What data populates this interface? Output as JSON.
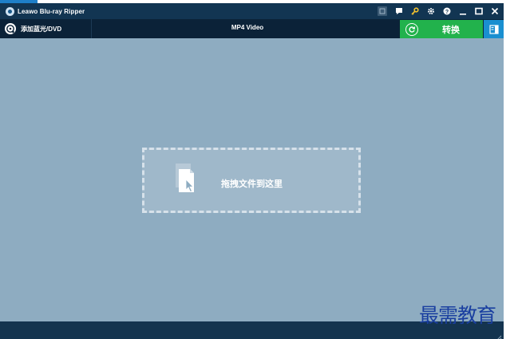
{
  "window": {
    "title": "Leawo Blu-ray Ripper"
  },
  "titlebar_icons": [
    "menu-box-icon",
    "chat-icon",
    "key-icon",
    "gear-icon",
    "help-icon",
    "minimize-icon",
    "maximize-icon",
    "close-icon"
  ],
  "toolbar": {
    "add_label": "添加蓝光/DVD",
    "format_label": "MP4 Video",
    "convert_label": "转换"
  },
  "dropzone": {
    "label": "拖拽文件到这里"
  },
  "watermark": "最需教育",
  "colors": {
    "titlebar": "#123552",
    "toolbar": "#0b2238",
    "content": "#8eacc1",
    "convert": "#22b24c",
    "layout_button": "#1a8fd0",
    "key_icon": "#f2c12e",
    "watermark": "#1a3fa0"
  }
}
